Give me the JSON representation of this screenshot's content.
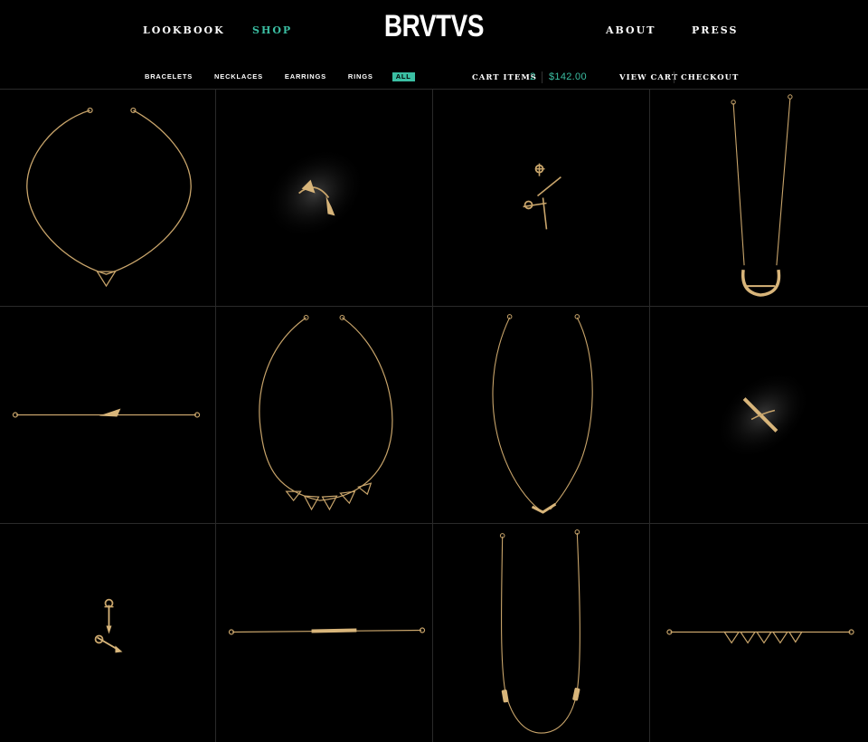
{
  "header": {
    "logo": "BRVTVS",
    "nav_left": [
      "LOOKBOOK",
      "SHOP"
    ],
    "nav_right": [
      "ABOUT",
      "PRESS"
    ],
    "active_nav": "SHOP"
  },
  "categories": {
    "items": [
      "BRACELETS",
      "NECKLACES",
      "EARRINGS",
      "RINGS",
      "ALL"
    ],
    "active": "ALL"
  },
  "cart": {
    "label": "CART ITEMS",
    "count": "2",
    "total": "$142.00",
    "view_cart": "VIEW CART",
    "checkout": "CHECKOUT"
  },
  "colors": {
    "accent": "#3bbfa3",
    "background": "#000000",
    "gold": "#c9a56b",
    "grid_line": "#2a2a2a"
  },
  "products": [
    {
      "type": "necklace",
      "icon": "triangle-pendant-necklace"
    },
    {
      "type": "ring",
      "icon": "spike-ring"
    },
    {
      "type": "earrings",
      "icon": "bar-stud-earrings"
    },
    {
      "type": "necklace",
      "icon": "horseshoe-pendant-necklace"
    },
    {
      "type": "bracelet",
      "icon": "spike-bracelet"
    },
    {
      "type": "necklace",
      "icon": "multi-triangle-necklace"
    },
    {
      "type": "necklace",
      "icon": "chevron-pendant-necklace"
    },
    {
      "type": "ring",
      "icon": "bar-ring"
    },
    {
      "type": "earrings",
      "icon": "arrow-stud-earrings"
    },
    {
      "type": "bracelet",
      "icon": "bar-bracelet"
    },
    {
      "type": "necklace",
      "icon": "double-charm-necklace"
    },
    {
      "type": "bracelet",
      "icon": "multi-triangle-bracelet"
    }
  ]
}
